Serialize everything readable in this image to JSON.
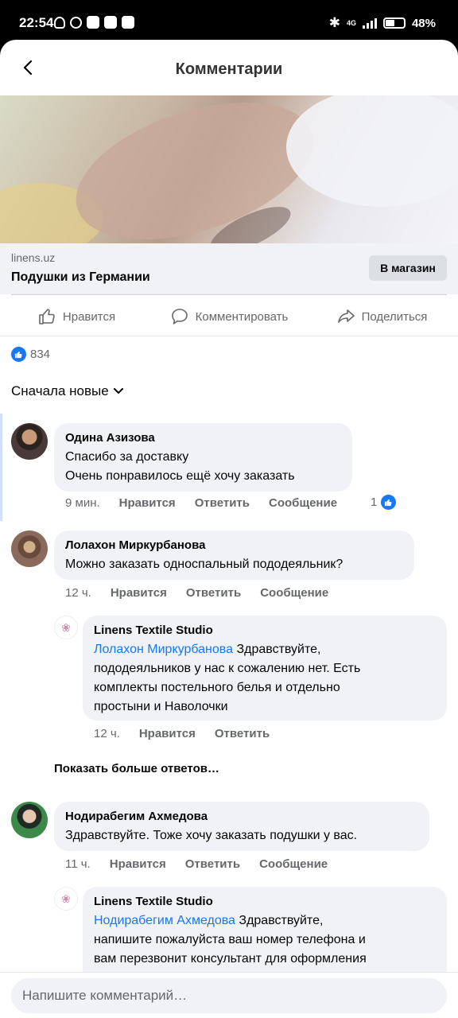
{
  "status_bar": {
    "time": "22:54",
    "network": "4G",
    "battery": "48%",
    "battery_level": 0.48
  },
  "header": {
    "title": "Комментарии"
  },
  "link_card": {
    "domain": "linens.uz",
    "title": "Подушки из Германии",
    "button": "В магазин"
  },
  "actions": {
    "like": "Нравится",
    "comment": "Комментировать",
    "share": "Поделиться"
  },
  "reactions": {
    "count": "834"
  },
  "sort": {
    "label": "Сначала новые"
  },
  "comments": [
    {
      "author": "Одина Азизова",
      "lines": [
        "Спасибо за доставку",
        "Очень понравилось ещё хочу заказать"
      ],
      "time": "9 мин.",
      "like": "Нравится",
      "reply": "Ответить",
      "message": "Сообщение",
      "reaction_count": "1"
    },
    {
      "author": "Лолахон Миркурбанова",
      "text": "Можно заказать односпальный пододеяльник?",
      "time": "12 ч.",
      "like": "Нравится",
      "reply": "Ответить",
      "message": "Сообщение",
      "reply_item": {
        "author": "Linens Textile Studio",
        "mention": "Лолахон Миркурбанова",
        "text_first": " Здравствуйте,",
        "lines": [
          "пододеяльников у нас к сожалению нет. Есть",
          "комплекты постельного белья и отдельно",
          "простыни и Наволочки"
        ],
        "time": "12 ч.",
        "like": "Нравится",
        "reply": "Ответить"
      }
    },
    {
      "author": "Нодирабегим Ахмедова",
      "text": "Здравствуйте. Тоже хочу заказать подушки у вас.",
      "time": "11 ч.",
      "like": "Нравится",
      "reply": "Ответить",
      "message": "Сообщение",
      "reply_item": {
        "author": "Linens Textile Studio",
        "mention": "Нодирабегим Ахмедова",
        "text_first": " Здравствуйте,",
        "lines": [
          "напишите пожалуйста ваш номер телефона и",
          "вам перезвонит консультант для оформления"
        ]
      }
    }
  ],
  "more_replies": "Показать больше ответов…",
  "composer": {
    "placeholder": "Напишите комментарий…"
  },
  "colors": {
    "accent": "#1877f2",
    "bubble": "#f0f2f5",
    "muted": "#65676b"
  }
}
